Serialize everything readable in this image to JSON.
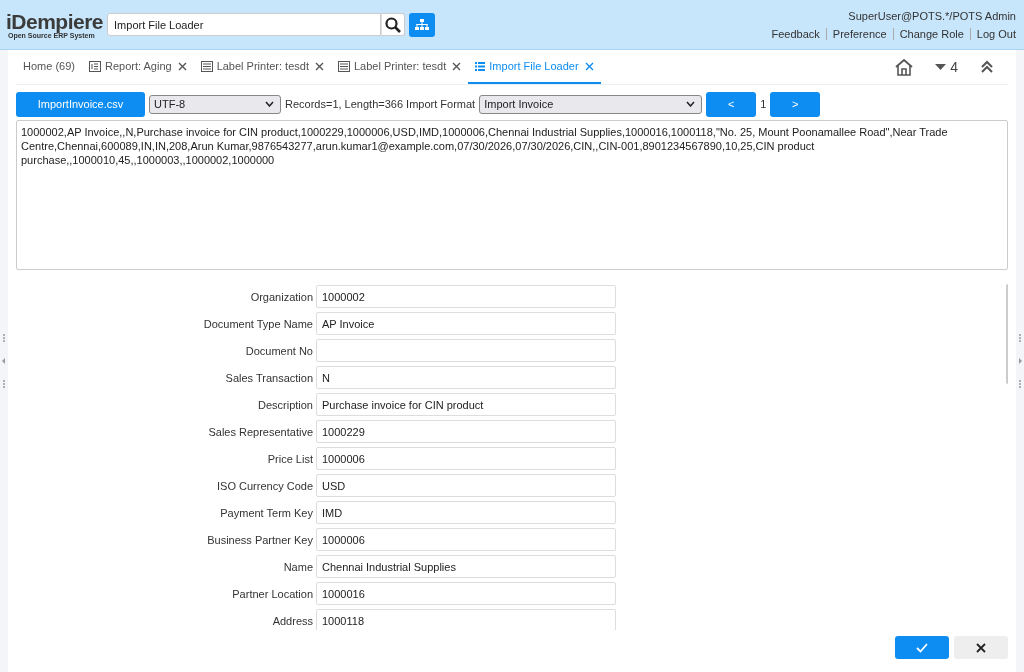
{
  "header": {
    "logo": "iDempiere",
    "logo_tagline": "Open Source ERP System",
    "search": {
      "value": "Import File Loader"
    },
    "user": "SuperUser@POTS.*/POTS Admin",
    "links": [
      "Feedback",
      "Preference",
      "Change Role",
      "Log Out"
    ]
  },
  "tabs": [
    {
      "label": "Home (69)",
      "kind": "home",
      "closable": false,
      "selected": false
    },
    {
      "label": "Report: Aging",
      "kind": "report",
      "closable": true,
      "selected": false
    },
    {
      "label": "Label Printer: tesdt",
      "kind": "form",
      "closable": true,
      "selected": false
    },
    {
      "label": "Label Printer: tesdt",
      "kind": "form",
      "closable": true,
      "selected": false
    },
    {
      "label": "Import File Loader",
      "kind": "list",
      "closable": true,
      "selected": true
    }
  ],
  "tab_count": "4",
  "toolbar": {
    "file_button": "ImportInvoice.csv",
    "charset": "UTF-8",
    "info": "Records=1, Length=366 Import Format",
    "format": "Import Invoice",
    "prev": "<",
    "record": "1",
    "next": ">"
  },
  "raw_data": "1000002,AP Invoice,,N,Purchase invoice for CIN product,1000229,1000006,USD,IMD,1000006,Chennai Industrial Supplies,1000016,1000118,\"No. 25, Mount Poonamallee Road\",Near Trade Centre,Chennai,600089,IN,IN,208,Arun Kumar,9876543277,arun.kumar1@example.com,07/30/2026,07/30/2026,CIN,,CIN-001,8901234567890,10,25,CIN product purchase,,1000010,45,,1000003,,1000002,1000000",
  "fields": [
    {
      "label": "Organization",
      "value": "1000002"
    },
    {
      "label": "Document Type Name",
      "value": "AP Invoice"
    },
    {
      "label": "Document No"
    },
    {
      "label": "Sales Transaction",
      "value": "N"
    },
    {
      "label": "Description",
      "value": "Purchase invoice for CIN product"
    },
    {
      "label": "Sales Representative",
      "value": "1000229"
    },
    {
      "label": "Price List",
      "value": "1000006"
    },
    {
      "label": "ISO Currency Code",
      "value": "USD"
    },
    {
      "label": "Payment Term Key",
      "value": "IMD"
    },
    {
      "label": "Business Partner Key",
      "value": "1000006"
    },
    {
      "label": "Name",
      "value": "Chennai Industrial Supplies"
    },
    {
      "label": "Partner Location",
      "value": "1000016"
    },
    {
      "label": "Address",
      "value": "1000118"
    }
  ]
}
